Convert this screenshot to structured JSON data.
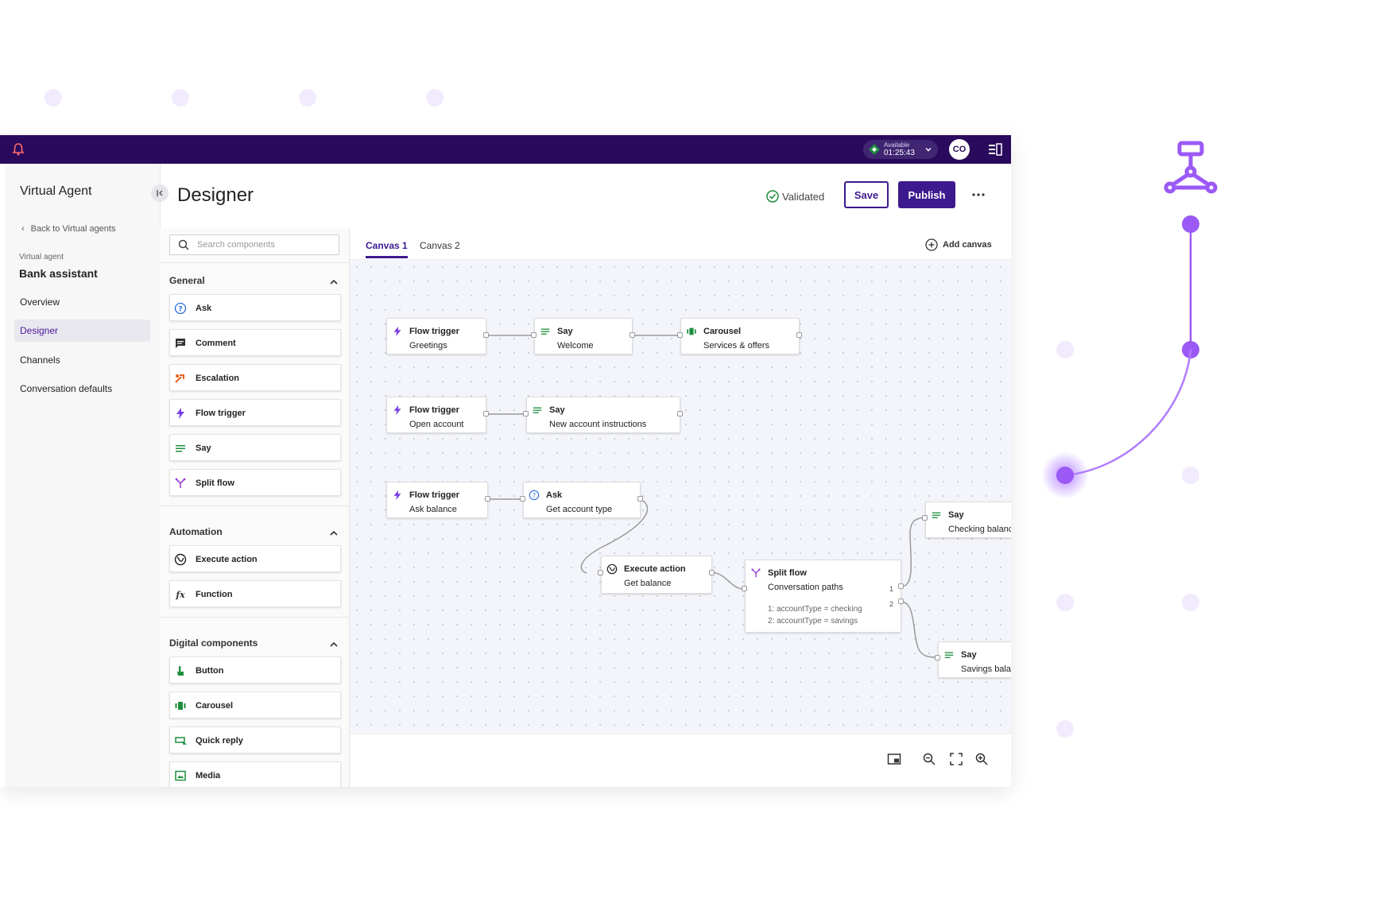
{
  "colors": {
    "brand": "#2a0a5c",
    "accent": "#3d1a8e",
    "success": "#1e8e3e",
    "canvas_bg": "#f3f5fb",
    "deco_purple": "#9b59f5"
  },
  "topbar": {
    "logo_icon": "bell-icon",
    "status_label": "Available",
    "status_time": "01:25:43",
    "avatar_initials": "CO",
    "panel_icon": "side-panel-icon"
  },
  "sidebar": {
    "title": "Virtual Agent",
    "back_link": "Back to Virtual agents",
    "agent_label": "Virtual agent",
    "agent_name": "Bank assistant",
    "items": [
      {
        "label": "Overview"
      },
      {
        "label": "Designer"
      },
      {
        "label": "Channels"
      },
      {
        "label": "Conversation defaults"
      }
    ],
    "active_item": "Designer"
  },
  "header": {
    "title": "Designer",
    "validated_label": "Validated",
    "save_label": "Save",
    "publish_label": "Publish"
  },
  "components": {
    "search_placeholder": "Search components",
    "sections": [
      {
        "title": "General",
        "items": [
          {
            "label": "Ask",
            "icon": "question-icon"
          },
          {
            "label": "Comment",
            "icon": "comment-icon"
          },
          {
            "label": "Escalation",
            "icon": "escalation-icon"
          },
          {
            "label": "Flow trigger",
            "icon": "lightning-icon"
          },
          {
            "label": "Say",
            "icon": "lines-icon"
          },
          {
            "label": "Split flow",
            "icon": "split-icon"
          }
        ]
      },
      {
        "title": "Automation",
        "items": [
          {
            "label": "Execute action",
            "icon": "globe-icon"
          },
          {
            "label": "Function",
            "icon": "function-icon"
          }
        ]
      },
      {
        "title": "Digital components",
        "items": [
          {
            "label": "Button",
            "icon": "hand-pointer-icon"
          },
          {
            "label": "Carousel",
            "icon": "carousel-icon"
          },
          {
            "label": "Quick reply",
            "icon": "quick-reply-icon"
          },
          {
            "label": "Media",
            "icon": "image-icon"
          }
        ]
      }
    ]
  },
  "canvas": {
    "tabs": [
      {
        "label": "Canvas 1"
      },
      {
        "label": "Canvas 2"
      }
    ],
    "active_tab": "Canvas 1",
    "add_canvas_label": "Add canvas",
    "nodes": [
      {
        "type": "Flow trigger",
        "label": "Greetings"
      },
      {
        "type": "Say",
        "label": "Welcome"
      },
      {
        "type": "Carousel",
        "label": "Services & offers"
      },
      {
        "type": "Flow trigger",
        "label": "Open account"
      },
      {
        "type": "Say",
        "label": "New account instructions"
      },
      {
        "type": "Flow trigger",
        "label": "Ask balance"
      },
      {
        "type": "Ask",
        "label": "Get account type"
      },
      {
        "type": "Execute action",
        "label": "Get balance"
      },
      {
        "type": "Split flow",
        "label": "Conversation paths",
        "conditions": [
          "1: accountType = checking",
          "2: accountType = savings"
        ],
        "ports": [
          "1",
          "2"
        ]
      },
      {
        "type": "Say",
        "label": "Checking balanc"
      },
      {
        "type": "Say",
        "label": "Savings balan"
      }
    ]
  },
  "toolbar": {
    "icons": [
      "minimap-icon",
      "zoom-out-icon",
      "fit-screen-icon",
      "zoom-in-icon"
    ]
  }
}
